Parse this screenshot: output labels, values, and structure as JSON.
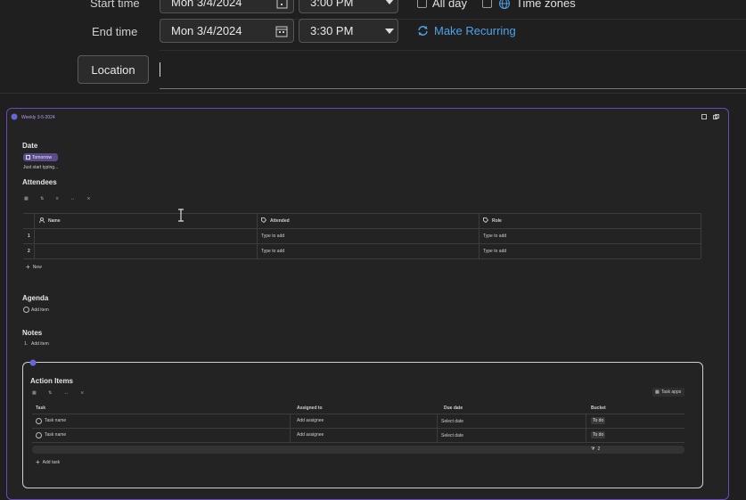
{
  "form": {
    "start_label": "Start time",
    "start_date": "Mon 3/4/2024",
    "start_time": "3:00 PM",
    "all_day": "All day",
    "time_zones": "Time zones",
    "end_label": "End time",
    "end_date": "Mon 3/4/2024",
    "end_time": "3:30 PM",
    "make_recurring": "Make Recurring",
    "location_button": "Location",
    "location_value": ""
  },
  "loop": {
    "title": "Weekly 3-5-2024",
    "date_heading": "Date",
    "date_chip": "Tomorrow",
    "hint": "Just start typing...",
    "attendees_heading": "Attendees",
    "columns": [
      "Name",
      "Attended",
      "Role"
    ],
    "rows": [
      {
        "num": "1",
        "name": "",
        "attended": "Type to add",
        "role": "Type to add"
      },
      {
        "num": "2",
        "name": "",
        "attended": "Type to add",
        "role": "Type to add"
      }
    ],
    "new_label": "New",
    "agenda_heading": "Agenda",
    "agenda_item": "Add item",
    "notes_heading": "Notes",
    "notes_num": "1.",
    "notes_item": "Add item"
  },
  "tasks": {
    "heading": "Action Items",
    "task_apps": "Task apps",
    "columns": [
      "Task",
      "Assigned to",
      "Due date",
      "Bucket"
    ],
    "rows": [
      {
        "task": "Task name",
        "assignee": "Add assignee",
        "due": "Select date",
        "bucket": "To do"
      },
      {
        "task": "Task name",
        "assignee": "Add assignee",
        "due": "Select date",
        "bucket": "To do"
      }
    ],
    "count": "2",
    "add_task": "Add task"
  },
  "colors": {
    "accent": "#4ea1e8",
    "card_border": "#6b4ab8",
    "background": "#1f1f1f"
  }
}
